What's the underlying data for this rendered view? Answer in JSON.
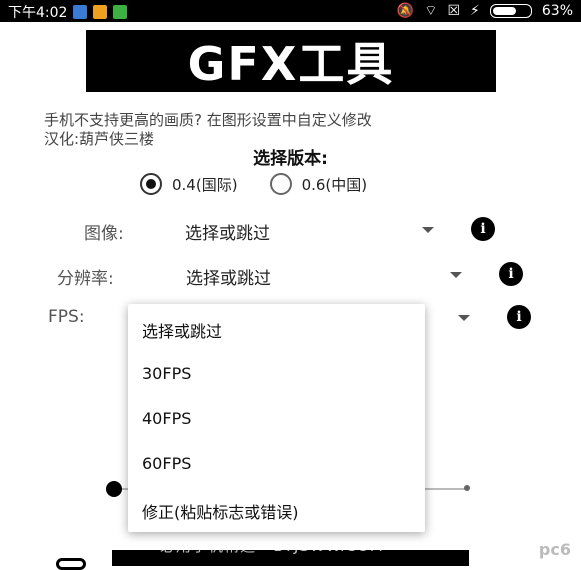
{
  "status_bar": {
    "time": "下午4:02",
    "battery": "63%",
    "battery_level": 0.63
  },
  "app": {
    "banner": "GFX工具",
    "hint_line1": "手机不支持更高的画质? 在图形设置中自定义修改",
    "hint_line2": "汉化:葫芦侠三楼",
    "version_title": "选择版本:",
    "versions": [
      {
        "label": "0.4(国际)",
        "selected": true
      },
      {
        "label": "0.6(中国)",
        "selected": false
      }
    ]
  },
  "settings": {
    "image_label": "图像:",
    "image_value": "选择或跳过",
    "resolution_label": "分辨率:",
    "resolution_value": "选择或跳过",
    "fps_label": "FPS:",
    "info_icon": "info-icon"
  },
  "dropdown": {
    "options": [
      "选择或跳过",
      "30FPS",
      "40FPS",
      "60FPS",
      "修正(粘贴标志或错误)"
    ]
  },
  "watermark": {
    "text": "必用手机精选 · BYJSWW.COM",
    "logo": "pc6"
  }
}
